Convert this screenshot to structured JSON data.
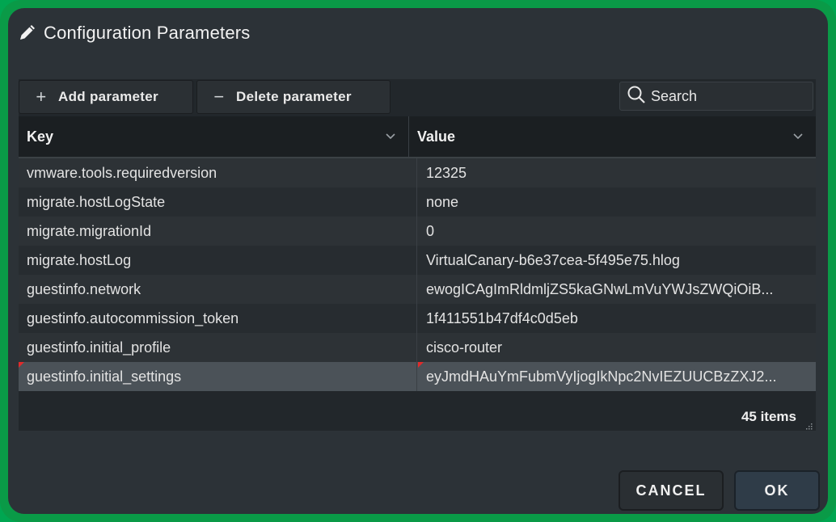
{
  "dialog": {
    "title": "Configuration Parameters",
    "icon": "pencil-icon"
  },
  "toolbar": {
    "add_label": "Add parameter",
    "delete_label": "Delete parameter",
    "search_placeholder": "Search"
  },
  "grid": {
    "columns": [
      {
        "label": "Key"
      },
      {
        "label": "Value"
      }
    ],
    "rows": [
      {
        "key": "vmware.tools.requiredversion",
        "value": "12325"
      },
      {
        "key": "migrate.hostLogState",
        "value": "none"
      },
      {
        "key": "migrate.migrationId",
        "value": "0"
      },
      {
        "key": "migrate.hostLog",
        "value": "VirtualCanary-b6e37cea-5f495e75.hlog"
      },
      {
        "key": "guestinfo.network",
        "value": "ewogICAgImRldmljZS5kaGNwLmVuYWJsZWQiOiB..."
      },
      {
        "key": "guestinfo.autocommission_token",
        "value": "1f411551b47df4c0d5eb"
      },
      {
        "key": "guestinfo.initial_profile",
        "value": "cisco-router"
      },
      {
        "key": "guestinfo.initial_settings",
        "value": "eyJmdHAuYmFubmVyIjogIkNpc2NvIEZUUCBzZXJ2..."
      }
    ],
    "selected_row": 7,
    "item_count": "45 items"
  },
  "actions": {
    "cancel_label": "CANCEL",
    "ok_label": "OK"
  },
  "colors": {
    "frame": "#0a9a47",
    "dialog_bg": "#2c3237",
    "selected_row": "#4b5258",
    "modified_marker": "#e02b2b"
  }
}
